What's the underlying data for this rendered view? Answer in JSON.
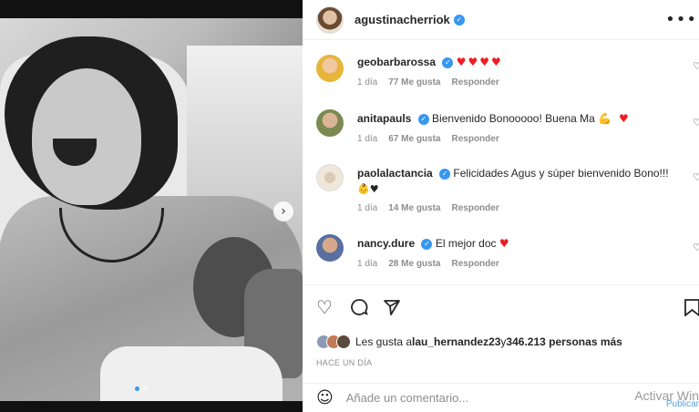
{
  "post": {
    "username": "agustinacherriok",
    "more_icon": "more-options-icon",
    "verified_symbol": "✓",
    "next_symbol": "›"
  },
  "comments": [
    {
      "username": "geobarbarossa",
      "text": "",
      "emoji": "♥♥♥♥",
      "time": "1 día",
      "likes": "77 Me gusta",
      "reply": "Responder",
      "avatar_color": "#e8b53b"
    },
    {
      "username": "anitapauls",
      "text": "Bienvenido Bonooooo! Buena Ma",
      "emoji": "💪 ♥",
      "time": "1 día",
      "likes": "67 Me gusta",
      "reply": "Responder",
      "avatar_color": "#7c8a52"
    },
    {
      "username": "paolalactancia",
      "text": "Felicidades Agus y súper bienvenido Bono!!!",
      "emoji": "👶♥",
      "time": "1 día",
      "likes": "14 Me gusta",
      "reply": "Responder",
      "avatar_color": "#efe7d9"
    },
    {
      "username": "nancy.dure",
      "text": "El mejor doc",
      "emoji": "♥",
      "time": "1 día",
      "likes": "28 Me gusta",
      "reply": "Responder",
      "avatar_color": "#5a6fa0"
    }
  ],
  "likes": {
    "prefix": "Les gusta a ",
    "user": "lau_hernandez23",
    "middle": " y ",
    "count": "346.213 personas más"
  },
  "time_ago": "HACE UN DÍA",
  "add_comment_placeholder": "Añade un comentario...",
  "watermark": {
    "line1": "Activar Win",
    "line2": "Publicar"
  },
  "colors": {
    "verified": "#3897f0",
    "heart_red": "#ed1c24",
    "muted": "#8e8e8e"
  }
}
